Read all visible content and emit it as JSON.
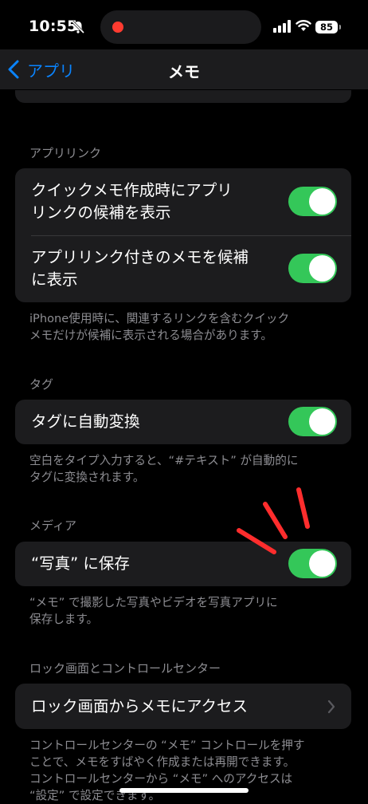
{
  "status_bar": {
    "time": "10:55",
    "battery": "85"
  },
  "nav": {
    "back_label": "アプリ",
    "title": "メモ"
  },
  "sections": {
    "app_links": {
      "header": "アプリリンク",
      "row1_line1": "クイックメモ作成時にアプリ",
      "row1_line2": "リンクの候補を表示",
      "row1_on": true,
      "row2_line1": "アプリリンク付きのメモを候補",
      "row2_line2": "に表示",
      "row2_on": true,
      "footer_line1": "iPhone使用時に、関連するリンクを含むクイック",
      "footer_line2": "メモだけが候補に表示される場合があります。"
    },
    "tags": {
      "header": "タグ",
      "row_label": "タグに自動変換",
      "row_on": true,
      "footer_line1": "空白をタイプ入力すると、“#テキスト” が自動的に",
      "footer_line2": "タグに変換されます。"
    },
    "media": {
      "header": "メディア",
      "row_label": "“写真” に保存",
      "row_on": true,
      "footer_line1": "“メモ” で撮影した写真やビデオを写真アプリに",
      "footer_line2": "保存します。"
    },
    "lock_screen": {
      "header": "ロック画面とコントロールセンター",
      "row_label": "ロック画面からメモにアクセス",
      "footer_line1": "コントロールセンターの “メモ” コントロールを押す",
      "footer_line2": "ことで、メモをすばやく作成または再開できます。",
      "footer_line3": "コントロールセンターから “メモ” へのアクセスは",
      "footer_line4": "“設定” で設定できます。"
    }
  },
  "colors": {
    "accent": "#0a84ff",
    "toggle_on": "#34c759",
    "card_bg": "#1c1c1e",
    "annotation": "#ff2d2d"
  }
}
